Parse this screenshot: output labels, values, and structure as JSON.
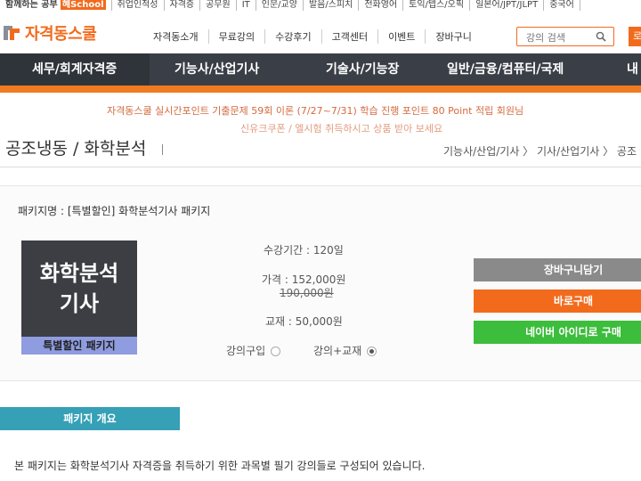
{
  "top_links": [
    "함께하는 공부",
    "취업인적성",
    "자격증",
    "공무원",
    "IT",
    "인문/교양",
    "발음/스피치",
    "전화영어",
    "토익/텝스/오픽",
    "일본어/JPT/JLPT",
    "중국어"
  ],
  "top_highlight": "혜School",
  "logo": {
    "text": "자격동스쿨"
  },
  "gnb": [
    "자격동소개",
    "무료강의",
    "수강후기",
    "고객센터",
    "이벤트",
    "장바구니"
  ],
  "search": {
    "placeholder": "강의 검색"
  },
  "login_label": "로",
  "main_nav": [
    {
      "label": "세무/회계자격증",
      "active": true
    },
    {
      "label": "기능사/산업기사"
    },
    {
      "label": "기술사/기능장"
    },
    {
      "label": "일반/금융/컴퓨터/국제"
    },
    {
      "label": "내"
    }
  ],
  "ticker": {
    "line1": "자격동스쿨 실시간포인트 기출문제 59회 이론 (7/27~7/31) 학습 진행 포인트 80 Point 적립 회원님",
    "line2": "신유크쿠폰 / 엘시험 취득하시고 상품 받아 보세요"
  },
  "page": {
    "title": "공조냉동 / 화학분석",
    "breadcrumb": "기능사/산업/기사 〉 기사/산업기사 〉 공조"
  },
  "package": {
    "name_label": "패키지명 : [특별할인] 화학분석기사 패키지",
    "thumb_title": "화학분석\n기사",
    "thumb_badge": "특별할인 패키지",
    "period": "수강기간 : 120일",
    "price": "가격 : 152,000원",
    "original_price": "190,000원",
    "book_price": "교재 : 50,000원",
    "option_lecture": "강의구입",
    "option_bundle": "강의+교재",
    "selected_option": "강의+교재"
  },
  "buttons": {
    "cart": "장바구니담기",
    "buy": "바로구매",
    "naver": "네이버 아이디로 구매"
  },
  "colors": {
    "cart": "#8a8a8a",
    "buy": "#f26b1d",
    "naver": "#3cbd3c",
    "nav_bg": "#3a3f47",
    "accent": "#f07a20"
  },
  "tab": {
    "label": "패키지 개요"
  },
  "description": "본 패키지는 화학분석기사 자격증을 취득하기 위한 과목별 필기 강의들로 구성되어 있습니다."
}
